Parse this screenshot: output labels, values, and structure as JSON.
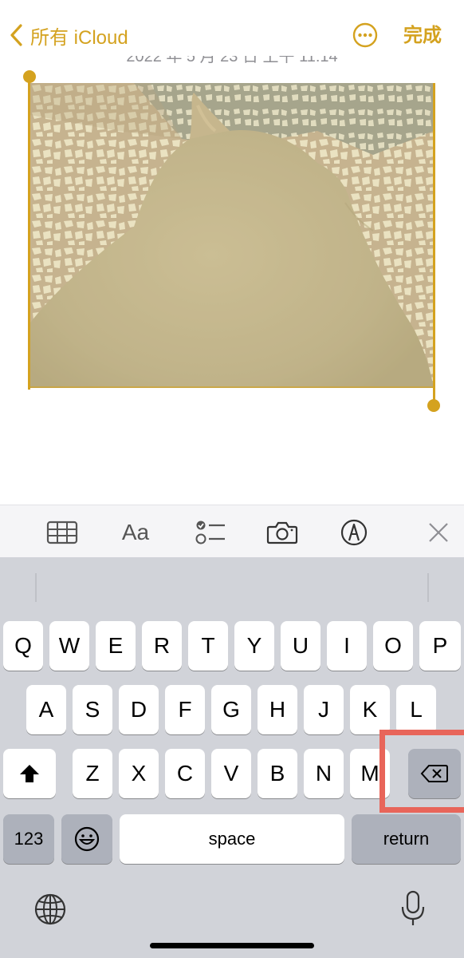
{
  "nav": {
    "back_label": "所有 iCloud",
    "done_label": "完成",
    "more_icon": "ellipsis-circle-icon"
  },
  "note": {
    "date_text": "2022 年 5 月 23 日 上午 11:14",
    "image_description_icon": "photo-of-cat"
  },
  "toolbar": {
    "items": [
      "table-icon",
      "Aa",
      "checklist-icon",
      "camera-icon",
      "markup-pen-icon",
      "close-icon"
    ],
    "format_label": "Aa"
  },
  "keyboard": {
    "row1": [
      "Q",
      "W",
      "E",
      "R",
      "T",
      "Y",
      "U",
      "I",
      "O",
      "P"
    ],
    "row2": [
      "A",
      "S",
      "D",
      "F",
      "G",
      "H",
      "J",
      "K",
      "L"
    ],
    "row3": [
      "Z",
      "X",
      "C",
      "V",
      "B",
      "N",
      "M"
    ],
    "numbers_label": "123",
    "space_label": "space",
    "return_label": "return",
    "shift_icon": "shift-icon",
    "delete_icon": "delete-backspace-icon",
    "emoji_icon": "emoji-icon",
    "globe_icon": "globe-icon",
    "mic_icon": "microphone-icon"
  },
  "colors": {
    "accent": "#d4a21f",
    "highlight": "#e8655a",
    "keyboard_bg": "#d1d3d9"
  }
}
